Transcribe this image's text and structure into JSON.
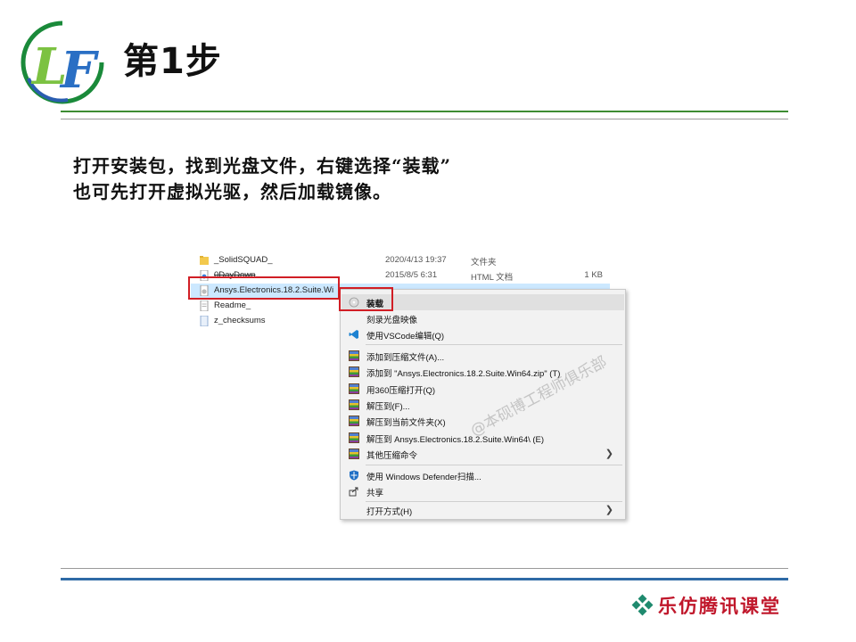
{
  "slide": {
    "title": "第1步",
    "logo_text": "LF",
    "instruction_line1": "打开安装包，找到光盘文件，右键选择“装载”",
    "instruction_line2": "也可先打开虚拟光驱，然后加载镜像。",
    "footer_brand": "乐仿腾讯课堂",
    "watermark": "@本砚博工程师俱乐部",
    "colors": {
      "green": "#3d8c33",
      "blue": "#2e6aa6",
      "red_highlight": "#d11e25",
      "brand_red": "#c0172b"
    }
  },
  "explorer": {
    "files": [
      {
        "name": "_SolidSQUAD_",
        "date": "2020/4/13 19:37",
        "type": "文件夹",
        "size": "",
        "icon": "folder-icon"
      },
      {
        "name": "0DayDown",
        "date": "2015/8/5 6:31",
        "type": "HTML 文档",
        "size": "1 KB",
        "icon": "html-file-icon"
      },
      {
        "name": "Ansys.Electronics.18.2.Suite.Wi",
        "date": "",
        "type": "",
        "size": "",
        "icon": "disc-image-icon"
      },
      {
        "name": "Readme_",
        "date": "",
        "type": "",
        "size": "",
        "icon": "text-file-icon"
      },
      {
        "name": "z_checksums",
        "date": "",
        "type": "",
        "size": "",
        "icon": "checksum-file-icon"
      }
    ]
  },
  "context_menu": {
    "items": [
      {
        "label": "装载",
        "icon": "mount-disc-icon"
      },
      {
        "label": "刻录光盘映像",
        "icon": ""
      },
      {
        "label": "使用VSCode编辑(Q)",
        "icon": "vscode-icon"
      },
      {
        "label": "添加到压缩文件(A)...",
        "icon": "winrar-icon"
      },
      {
        "label": "添加到 \"Ansys.Electronics.18.2.Suite.Win64.zip\" (T)",
        "icon": "winrar-icon"
      },
      {
        "label": "用360压缩打开(Q)",
        "icon": "winrar-icon"
      },
      {
        "label": "解压到(F)...",
        "icon": "winrar-icon"
      },
      {
        "label": "解压到当前文件夹(X)",
        "icon": "winrar-icon"
      },
      {
        "label": "解压到 Ansys.Electronics.18.2.Suite.Win64\\ (E)",
        "icon": "winrar-icon"
      },
      {
        "label": "其他压缩命令",
        "icon": "winrar-icon"
      },
      {
        "label": "使用 Windows Defender扫描...",
        "icon": "defender-shield-icon"
      },
      {
        "label": "共享",
        "icon": "share-icon"
      },
      {
        "label": "打开方式(H)",
        "icon": ""
      }
    ]
  }
}
